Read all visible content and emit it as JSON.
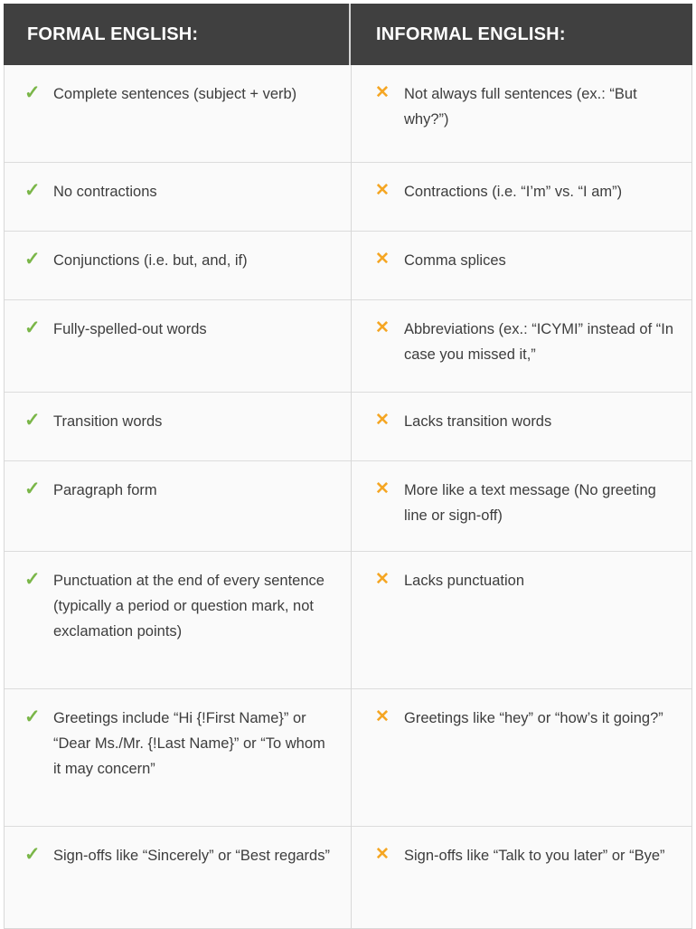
{
  "header": {
    "left_label": "FORMAL ENGLISH:",
    "right_label": "INFORMAL ENGLISH:",
    "background_color": "#404040",
    "text_color": "#FFFFFF"
  },
  "icons": {
    "check_glyph": "✓",
    "check_color": "#7AB648",
    "cross_glyph": "✕",
    "cross_color": "#F5A623"
  },
  "colors": {
    "cell_background": "#FAFAFA",
    "divider": "#DCDCDC",
    "body_text": "#3D3D3D"
  },
  "rows": [
    {
      "formal": "Complete sentences (subject + verb)",
      "informal": "Not always full sentences (ex.: “But why?”)"
    },
    {
      "formal": "No contractions",
      "informal": "Contractions (i.e. “I’m” vs. “I am”)"
    },
    {
      "formal": "Conjunctions (i.e. but, and, if)",
      "informal": "Comma splices"
    },
    {
      "formal": "Fully-spelled-out words",
      "informal": "Abbreviations (ex.: “ICYMI” instead of “In case you missed it,”"
    },
    {
      "formal": "Transition words",
      "informal": "Lacks transition words"
    },
    {
      "formal": "Paragraph form",
      "informal": "More like a text message (No greeting line or sign-off)"
    },
    {
      "formal": "Punctuation at the end of every sentence (typically a period or question mark, not exclamation points)",
      "informal": "Lacks punctuation"
    },
    {
      "formal": "Greetings include “Hi {!First Name}” or “Dear Ms./Mr. {!Last Name}” or “To whom it may concern”",
      "informal": "Greetings like “hey” or “how’s it going?”"
    },
    {
      "formal": "Sign-offs like “Sincerely” or “Best regards”",
      "informal": "Sign-offs like “Talk to you later” or “Bye”"
    }
  ]
}
